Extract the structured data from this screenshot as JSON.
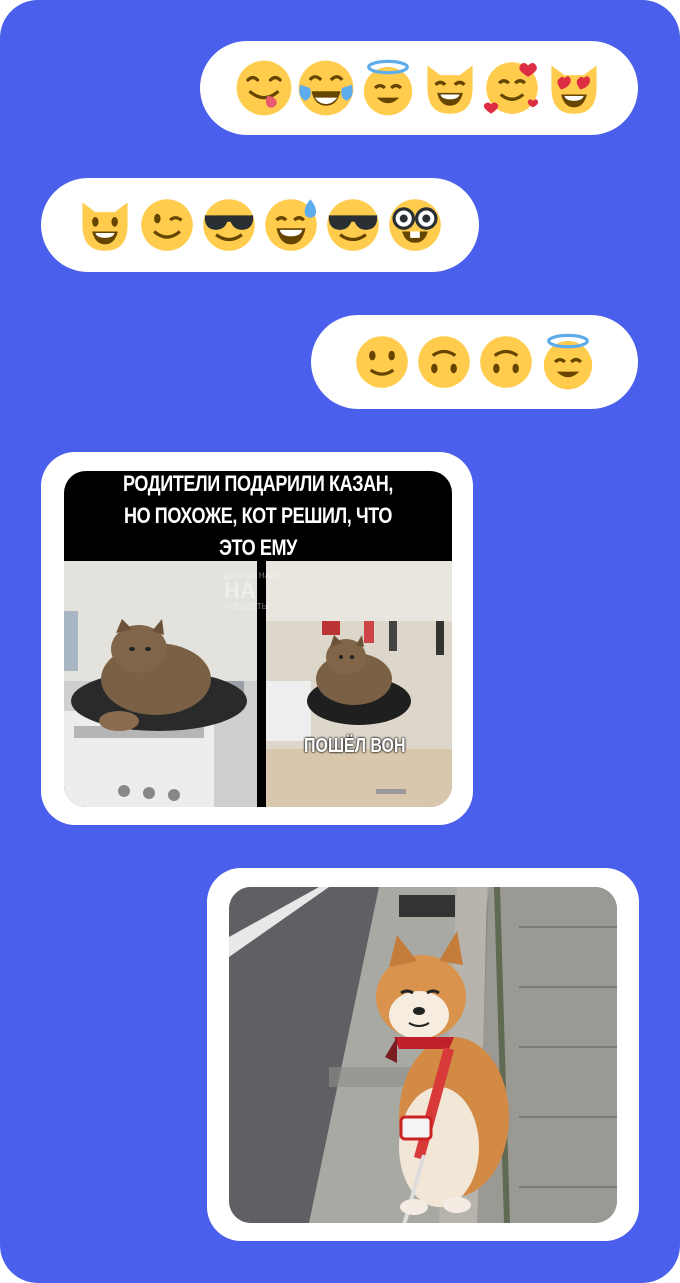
{
  "messages": [
    {
      "type": "emoji",
      "emojis": [
        "face-savoring-food",
        "face-with-tears-of-joy",
        "smiling-face-with-halo",
        "grinning-cat",
        "smiling-face-with-hearts",
        "smiling-cat-heart-eyes"
      ]
    },
    {
      "type": "emoji",
      "emojis": [
        "grinning-cat",
        "winking-face",
        "smiling-face-with-sunglasses",
        "grinning-face-with-sweat",
        "smiling-face-with-sunglasses",
        "nerd-face"
      ]
    },
    {
      "type": "emoji",
      "emojis": [
        "slightly-smiling-face",
        "upside-down-face",
        "upside-down-face",
        "smiling-face-with-halo"
      ]
    },
    {
      "type": "image",
      "meme": {
        "caption": "РОДИТЕЛИ ПОДАРИЛИ КАЗАН, НО ПОХОЖЕ, КОТ РЕШИЛ, ЧТО ЭТО ЕМУ",
        "subcaption": "ПОШЁЛ ВОН",
        "watermark_top": "ДЕТИЦА НАШ",
        "watermark_big": "НА",
        "watermark_bottom": "АНЕКДОТЫ"
      }
    },
    {
      "type": "image",
      "photo": "shiba-inu-on-leash"
    }
  ],
  "colors": {
    "background": "#4a5fec",
    "bubble": "#ffffff",
    "emoji_yellow": "#ffcc4d"
  }
}
